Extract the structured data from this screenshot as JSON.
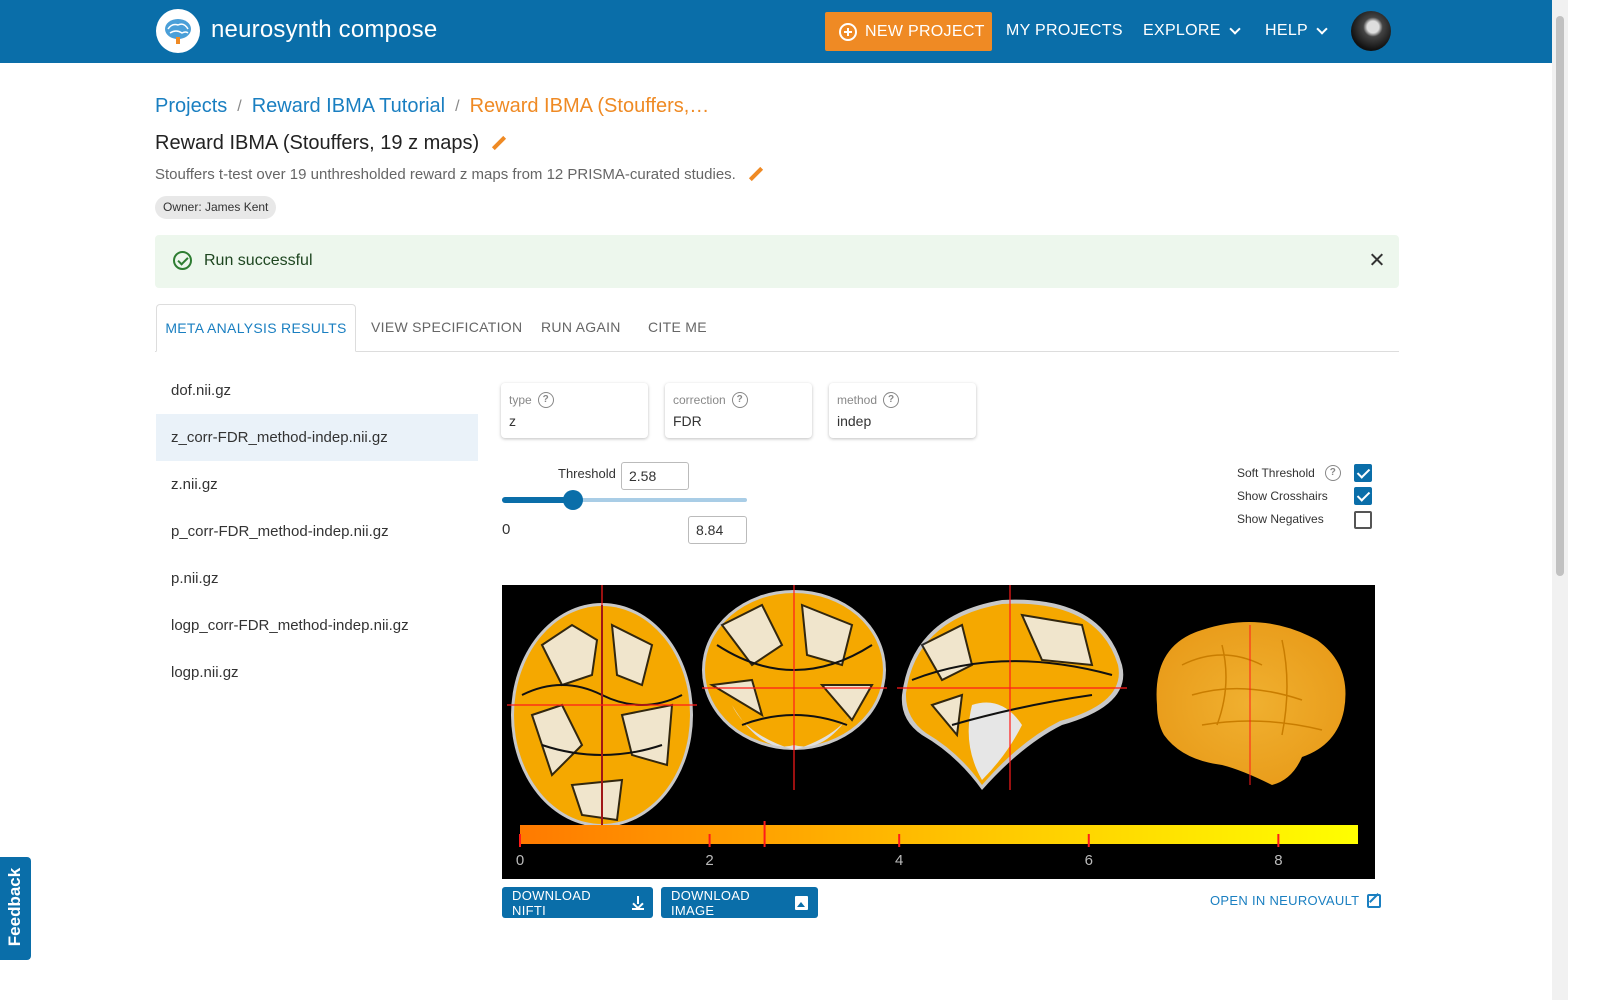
{
  "nav": {
    "brand": "neurosynth compose",
    "new_project": "NEW PROJECT",
    "my_projects": "MY PROJECTS",
    "explore": "EXPLORE",
    "help": "HELP",
    "accent_color": "#0a6ea9",
    "button_color": "#ef8a24"
  },
  "breadcrumb": {
    "projects": "Projects",
    "tutorial": "Reward IBMA Tutorial",
    "current": "Reward IBMA (Stouffers,…"
  },
  "header": {
    "title": "Reward IBMA (Stouffers, 19 z maps)",
    "description": "Stouffers t-test over 19 unthresholded reward z maps from 12 PRISMA-curated studies.",
    "owner": "Owner: James Kent"
  },
  "alert": {
    "text": "Run successful",
    "color": "#edf7ed"
  },
  "tabs": [
    "META ANALYSIS RESULTS",
    "VIEW SPECIFICATION",
    "RUN AGAIN",
    "CITE ME"
  ],
  "files": [
    "dof.nii.gz",
    "z_corr-FDR_method-indep.nii.gz",
    "z.nii.gz",
    "p_corr-FDR_method-indep.nii.gz",
    "p.nii.gz",
    "logp_corr-FDR_method-indep.nii.gz",
    "logp.nii.gz"
  ],
  "selected_file_index": 1,
  "fields": {
    "type": {
      "label": "type",
      "value": "z"
    },
    "correction": {
      "label": "correction",
      "value": "FDR"
    },
    "method": {
      "label": "method",
      "value": "indep"
    }
  },
  "threshold": {
    "label": "Threshold",
    "value": "2.58",
    "min": "0",
    "max": "8.84",
    "fraction": 0.29
  },
  "options": {
    "soft_threshold": {
      "label": "Soft Threshold",
      "checked": true
    },
    "show_crosshairs": {
      "label": "Show Crosshairs",
      "checked": true
    },
    "show_negatives": {
      "label": "Show Negatives",
      "checked": false
    }
  },
  "viewer": {
    "colorbar_ticks": [
      "0",
      "2",
      "4",
      "6",
      "8"
    ],
    "colorbar_max": 8.84,
    "threshold_marker": 2.58
  },
  "buttons": {
    "download_nifti": "DOWNLOAD NIFTI",
    "download_image": "DOWNLOAD IMAGE",
    "open_neurovault": "OPEN IN NEUROVAULT"
  },
  "feedback": "Feedback"
}
